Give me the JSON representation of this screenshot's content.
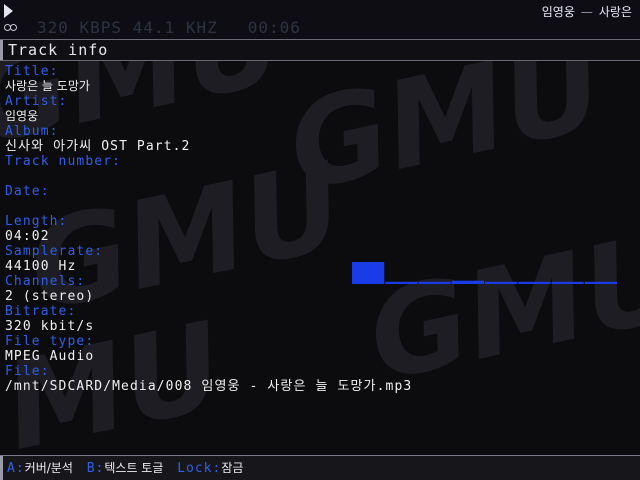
{
  "status": {
    "lcd_text": "320 KBPS 44.1 KHZ",
    "time": "00:06",
    "now_playing_artist": "임영웅",
    "now_playing_separator": "—",
    "now_playing_title": "사랑은"
  },
  "header": {
    "title": "Track info"
  },
  "track": {
    "title_label": "Title:",
    "title": "사랑은 늘 도망가",
    "artist_label": "Artist:",
    "artist": "임영웅",
    "album_label": "Album:",
    "album": "신사와 아가씨 OST Part.2",
    "track_number_label": "Track number:",
    "track_number": "",
    "date_label": "Date:",
    "date": "",
    "length_label": "Length:",
    "length": "04:02",
    "samplerate_label": "Samplerate:",
    "samplerate": "44100 Hz",
    "channels_label": "Channels:",
    "channels": "2 (stereo)",
    "bitrate_label": "Bitrate:",
    "bitrate": "320 kbit/s",
    "file_type_label": "File type:",
    "file_type": "MPEG Audio",
    "file_label": "File:",
    "file": "/mnt/SDCARD/Media/008 임영웅 - 사랑은 늘 도망가.mp3"
  },
  "spectrum": {
    "levels": [
      1.0,
      0.1,
      0.1,
      0.15,
      0.1,
      0.1,
      0.1,
      0.1
    ]
  },
  "footer": {
    "key_a": "A:",
    "action_a": "커버/분석",
    "key_b": "B:",
    "action_b": "텍스트 토글",
    "key_lock": "Lock:",
    "action_lock": "잠금"
  },
  "colors": {
    "label": "#2f5fe8",
    "value": "#f0f0f0",
    "spectrum": "#1a3be8",
    "background": "#0c0c0e"
  },
  "icons": {
    "play": "play-icon",
    "stereo": "stereo-icon"
  }
}
